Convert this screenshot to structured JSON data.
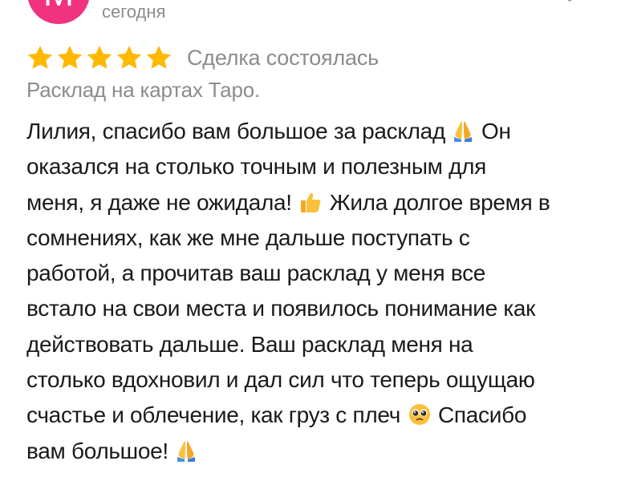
{
  "author": {
    "avatar_letter": "М",
    "avatar_color": "#f0327f",
    "date": "сегодня"
  },
  "menu": {
    "icon": "more-vertical-icon"
  },
  "rating": {
    "stars": 5,
    "max_stars": 5,
    "star_color": "#ffb800",
    "status": "Сделка состоялась"
  },
  "category": "Расклад на картах Таро.",
  "review": {
    "lines": [
      {
        "text": "Лилия, спасибо вам большое за расклад",
        "emoji": "pray-emoji-icon",
        "after": "Он"
      },
      {
        "text": "оказался на столько точным и полезным для"
      },
      {
        "text": "меня, я даже не ожидала!",
        "emoji": "thumbs-up-emoji-icon",
        "after": "Жила долгое время в"
      },
      {
        "text": "сомнениях, как же мне дальше поступать с"
      },
      {
        "text": "работой, а прочитав ваш расклад у меня все"
      },
      {
        "text": "встало на свои места и появилось понимание как"
      },
      {
        "text": "действовать дальше. Ваш расклад меня на"
      },
      {
        "text": "столько вдохновил и дал сил что теперь ощущаю"
      },
      {
        "text": "счастье и облечение, как груз с плеч",
        "emoji": "pleading-face-emoji-icon",
        "after": "Спасибо"
      },
      {
        "text": "вам большое!",
        "emoji": "pray-emoji-icon",
        "after": ""
      }
    ]
  }
}
